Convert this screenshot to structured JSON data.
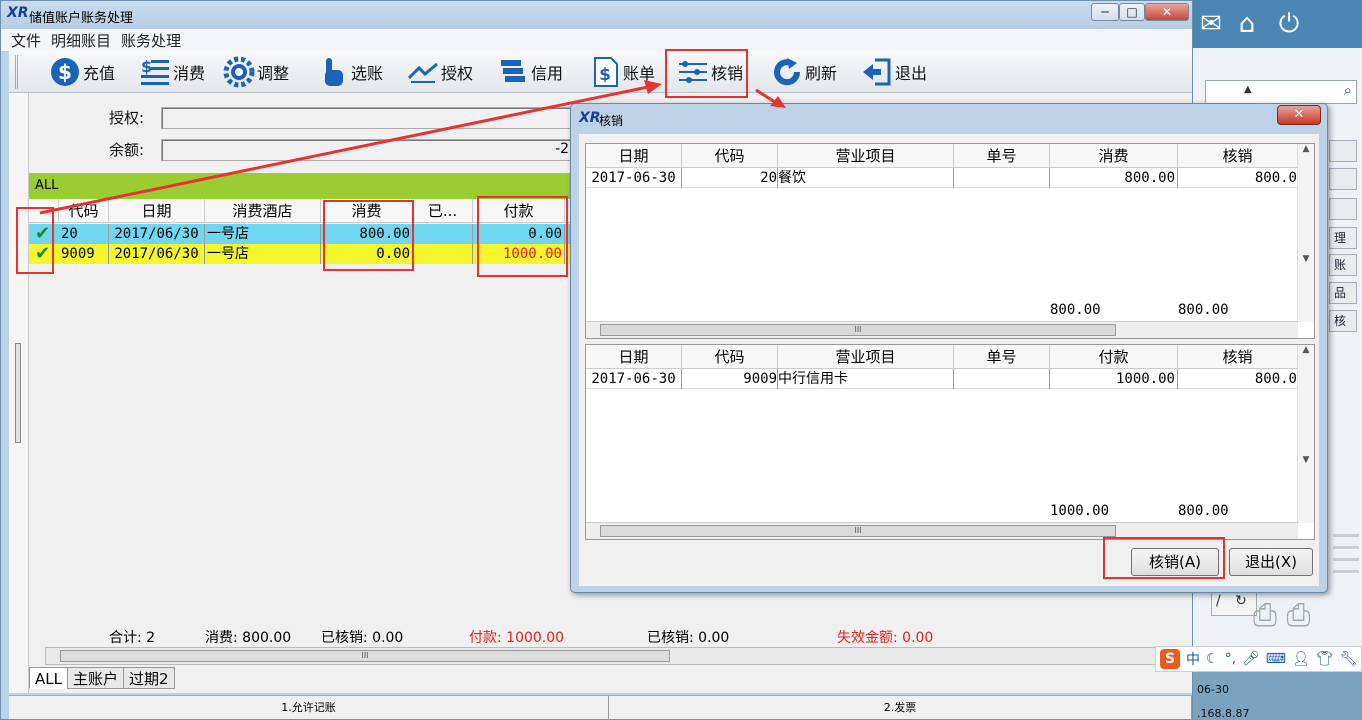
{
  "background_app": {
    "bottom_text_1": "06-30",
    "bottom_text_2": ".168.8.87",
    "side_buttons": [
      "理",
      "账",
      "品",
      "核"
    ],
    "small_box": "/",
    "ime_label": "中",
    "ime_punct": "°,"
  },
  "main_window": {
    "title": "储值账户账务处理",
    "logo": "XR",
    "buttons": {
      "min": "─",
      "max": "□",
      "close": "✕"
    },
    "menu": [
      "文件",
      "明细账目",
      "账务处理"
    ],
    "toolbar": [
      {
        "label": "充值",
        "icon": "dollar-coin-icon"
      },
      {
        "label": "消费",
        "icon": "dollar-list-icon"
      },
      {
        "label": "调整",
        "icon": "gear-icon"
      },
      {
        "label": "选账",
        "icon": "hand-pointer-icon"
      },
      {
        "label": "授权",
        "icon": "handshake-icon"
      },
      {
        "label": "信用",
        "icon": "stack-icon"
      },
      {
        "label": "账单",
        "icon": "bill-icon"
      },
      {
        "label": "核销",
        "icon": "abacus-icon"
      },
      {
        "label": "刷新",
        "icon": "refresh-icon"
      },
      {
        "label": "退出",
        "icon": "exit-icon"
      }
    ],
    "form": {
      "auth_label": "授权:",
      "balance_label": "余额:",
      "balance_value": "-20"
    },
    "grid": {
      "group_label": "ALL",
      "columns": [
        "代码",
        "日期",
        "消费酒店",
        "消费",
        "已...",
        "付款"
      ],
      "rows": [
        {
          "checked": "✔",
          "code": "20",
          "date": "2017/06/30",
          "hotel": "一号店",
          "consume": "800.00",
          "paid": "0.00",
          "bg": "#6fd7f2"
        },
        {
          "checked": "✔",
          "code": "9009",
          "date": "2017/06/30",
          "hotel": "一号店",
          "consume": "0.00",
          "paid": "1000.00",
          "bg": "#f5f52e"
        }
      ]
    },
    "summary": {
      "count": "合计: 2",
      "consume": "消费: 800.00",
      "written_off_1": "已核销: 0.00",
      "payment": "付款: 1000.00",
      "written_off_2": "已核销: 0.00",
      "expired": "失效金额: 0.00"
    },
    "tabs": [
      "ALL",
      "主账户",
      "过期2"
    ],
    "status": [
      "1.允许记账",
      "2.发票"
    ]
  },
  "dialog": {
    "title": "核销",
    "logo": "XR",
    "close": "✕",
    "top_grid": {
      "columns": [
        "日期",
        "代码",
        "营业项目",
        "单号",
        "消费",
        "核销"
      ],
      "rows": [
        {
          "date": "2017-06-30",
          "code": "20",
          "item": "餐饮",
          "no": "",
          "amount": "800.00",
          "writeoff": "800.0"
        }
      ],
      "total_amount": "800.00",
      "total_writeoff": "800.00"
    },
    "bottom_grid": {
      "columns": [
        "日期",
        "代码",
        "营业项目",
        "单号",
        "付款",
        "核销"
      ],
      "rows": [
        {
          "date": "2017-06-30",
          "code": "9009",
          "item": "中行信用卡",
          "no": "",
          "amount": "1000.00",
          "writeoff": "800.0"
        }
      ],
      "total_amount": "1000.00",
      "total_writeoff": "800.00"
    },
    "buttons": {
      "writeoff": "核销(A)",
      "exit": "退出(X)"
    }
  },
  "colors": {
    "highlight": "#e53333",
    "group_bar": "#9acd32",
    "row1": "#6fd7f2",
    "row2": "#f5f52e",
    "red_text": "#e02020"
  }
}
